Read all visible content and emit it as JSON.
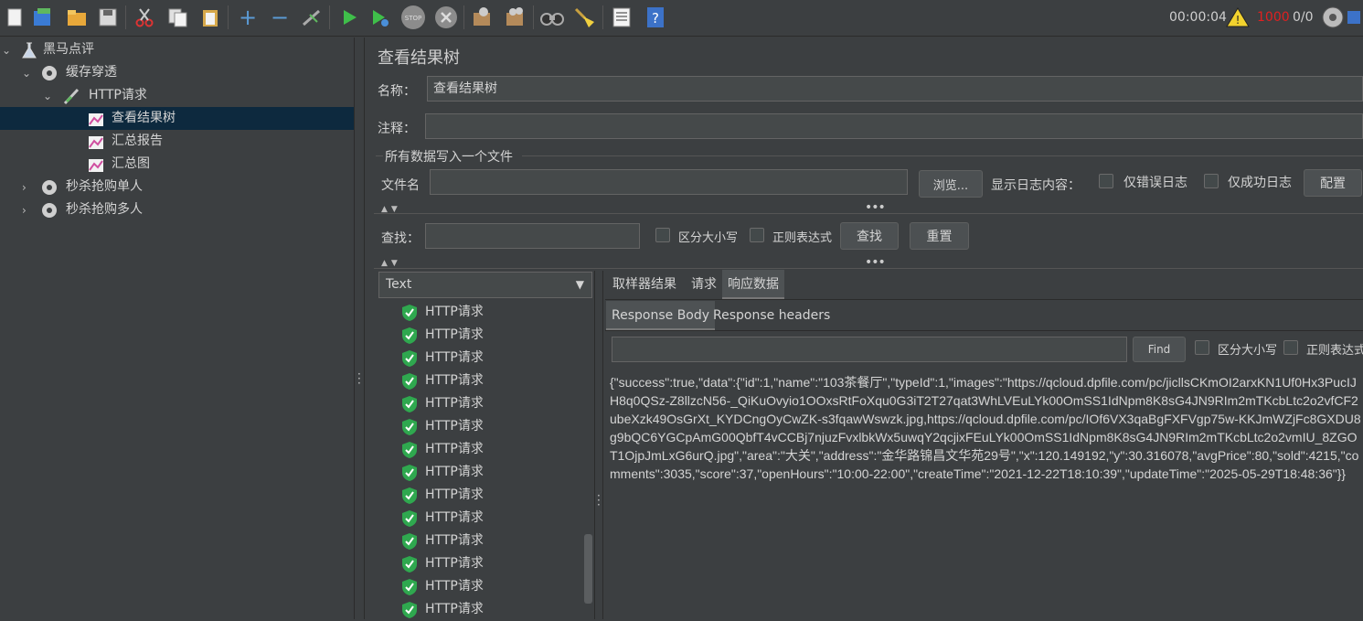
{
  "toolbar": {
    "elapsed": "00:00:04",
    "warning_count": "1000",
    "thread_ratio": "0/0"
  },
  "tree": {
    "root": "黑马点评",
    "group1": "缓存穿透",
    "sampler": "HTTP请求",
    "view_results": "查看结果树",
    "summary_report": "汇总报告",
    "summary_graph": "汇总图",
    "group2": "秒杀抢购单人",
    "group3": "秒杀抢购多人"
  },
  "panel": {
    "title": "查看结果树",
    "name_label": "名称：",
    "name_value": "查看结果树",
    "comment_label": "注释：",
    "comment_value": "",
    "file_section": "所有数据写入一个文件",
    "filename_label": "文件名",
    "filename_value": "",
    "browse_button": "浏览...",
    "log_label": "显示日志内容：",
    "errors_only": "仅错误日志",
    "success_only": "仅成功日志",
    "config_button": "配置",
    "search_label": "查找：",
    "search_value": "",
    "case_sensitive": "区分大小写",
    "regex": "正则表达式",
    "find_button": "查找",
    "reset_button": "重置"
  },
  "results": {
    "renderer": "Text",
    "items": [
      "HTTP请求",
      "HTTP请求",
      "HTTP请求",
      "HTTP请求",
      "HTTP请求",
      "HTTP请求",
      "HTTP请求",
      "HTTP请求",
      "HTTP请求",
      "HTTP请求",
      "HTTP请求",
      "HTTP请求",
      "HTTP请求",
      "HTTP请求"
    ]
  },
  "detail": {
    "tabs": [
      "取样器结果",
      "请求",
      "响应数据"
    ],
    "active_tab": 2,
    "subtabs": [
      "Response Body",
      "Response headers"
    ],
    "find_button": "Find",
    "case_sensitive": "区分大小写",
    "regex": "正则表达式",
    "body": "{\"success\":true,\"data\":{\"id\":1,\"name\":\"103茶餐厅\",\"typeId\":1,\"images\":\"https://qcloud.dpfile.com/pc/jicllsCKmOI2arxKN1Uf0Hx3PucIJH8q0QSz-Z8llzcN56-_QiKuOvyio1OOxsRtFoXqu0G3iT2T27qat3WhLVEuLYk00OmSS1IdNpm8K8sG4JN9RIm2mTKcbLtc2o2vfCF2ubeXzk49OsGrXt_KYDCngOyCwZK-s3fqawWswzk.jpg,https://qcloud.dpfile.com/pc/IOf6VX3qaBgFXFVgp75w-KKJmWZjFc8GXDU8g9bQC6YGCpAmG00QbfT4vCCBj7njuzFvxlbkWx5uwqY2qcjixFEuLYk00OmSS1IdNpm8K8sG4JN9RIm2mTKcbLtc2o2vmIU_8ZGOT1OjpJmLxG6urQ.jpg\",\"area\":\"大关\",\"address\":\"金华路锦昌文华苑29号\",\"x\":120.149192,\"y\":30.316078,\"avgPrice\":80,\"sold\":4215,\"comments\":3035,\"score\":37,\"openHours\":\"10:00-22:00\",\"createTime\":\"2021-12-22T18:10:39\",\"updateTime\":\"2025-05-29T18:48:36\"}}"
  },
  "colors": {
    "accent_selected": "#0d293e",
    "warning_red": "#e02020",
    "success_green": "#2fa84f"
  }
}
